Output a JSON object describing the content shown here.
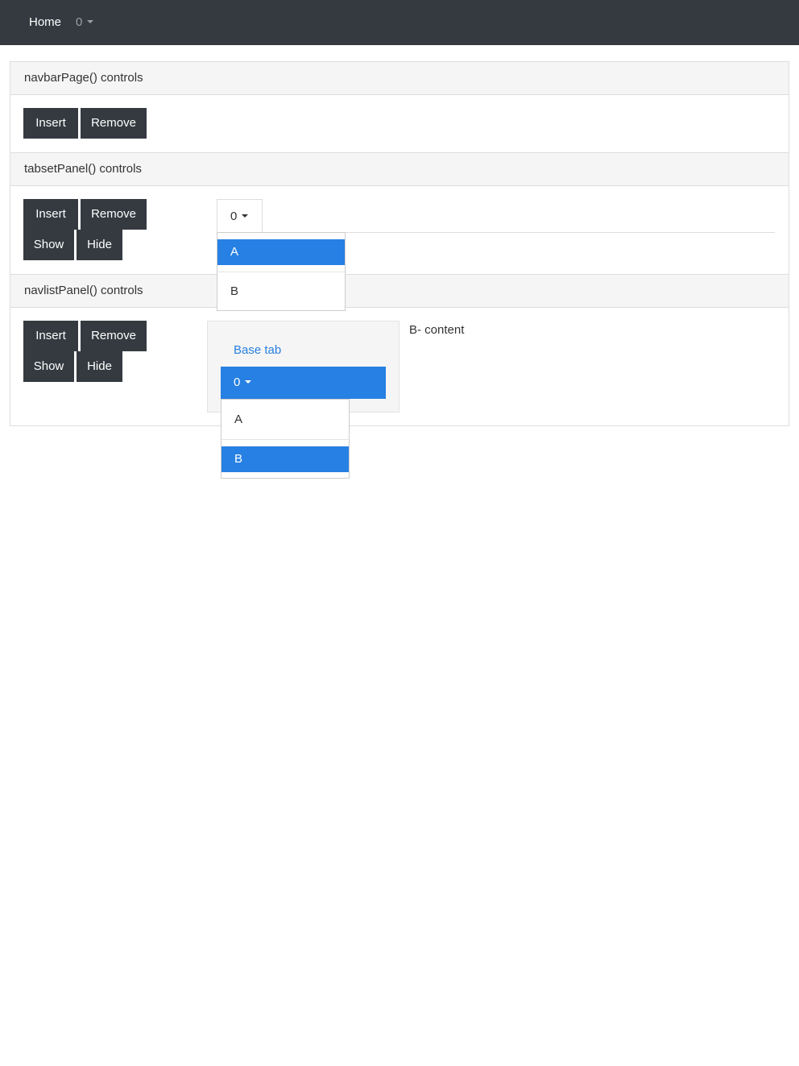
{
  "navbar": {
    "home_label": "Home",
    "menu_label": "0"
  },
  "navbar_panel": {
    "heading": "navbarPage() controls",
    "insert_label": "Insert",
    "remove_label": "Remove"
  },
  "tabset_panel": {
    "heading": "tabsetPanel() controls",
    "insert_label": "Insert",
    "remove_label": "Remove",
    "show_label": "Show",
    "hide_label": "Hide",
    "menu_label": "0",
    "dropdown_items": [
      "A",
      "B"
    ],
    "selected_item": "A"
  },
  "navlist_panel": {
    "heading": "navlistPanel() controls",
    "insert_label": "Insert",
    "remove_label": "Remove",
    "show_label": "Show",
    "hide_label": "Hide",
    "base_tab_label": "Base tab",
    "menu_label": "0",
    "dropdown_items": [
      "A",
      "B"
    ],
    "selected_item": "B",
    "content_text": "B- content"
  },
  "colors": {
    "navbar_bg": "#343a40",
    "button_bg": "#343a40",
    "accent": "#2780e3",
    "panel_heading_bg": "#f5f5f5"
  },
  "icons": {
    "dropdown_caret": "caret-down-icon"
  }
}
